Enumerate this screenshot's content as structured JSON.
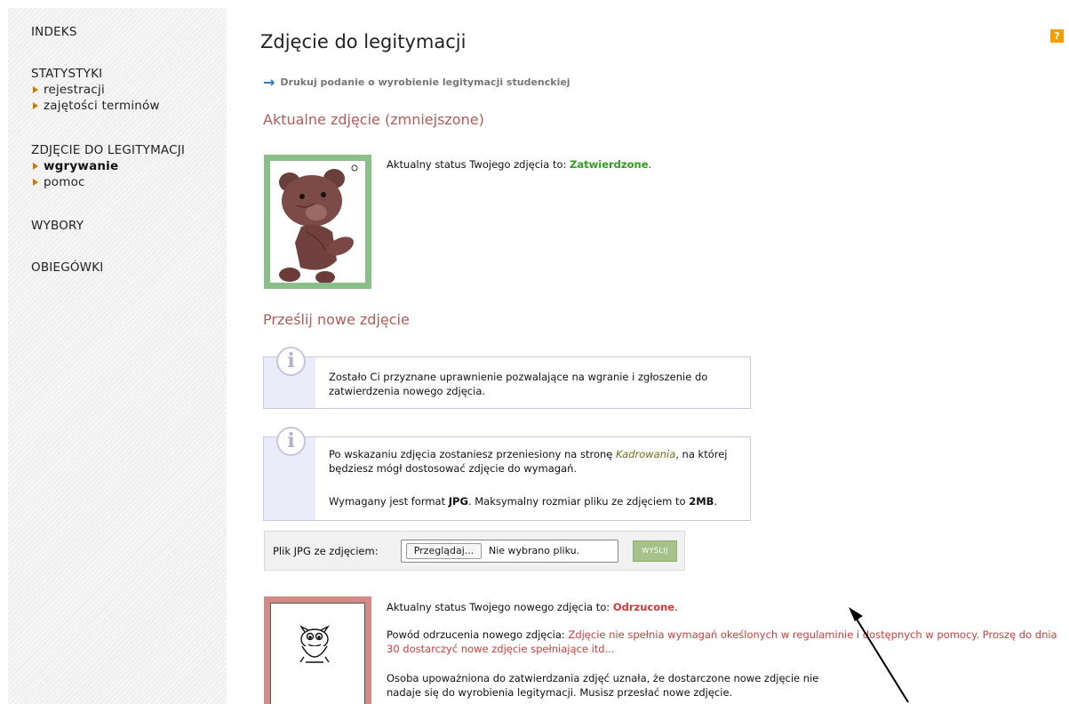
{
  "sidebar": {
    "indeks": "INDEKS",
    "statystyki": {
      "title": "STATYSTYKI",
      "items": [
        "rejestracji",
        "zajętości terminów"
      ]
    },
    "zdjecie": {
      "title": "ZDJĘCIE DO LEGITYMACJI",
      "items": [
        "wgrywanie",
        "pomoc"
      ]
    },
    "wybory": "WYBORY",
    "obiegowki": "OBIEGÓWKI"
  },
  "help_icon": "?",
  "page_title": "Zdjęcie do legitymacji",
  "print_link": "Drukuj podanie o wyrobienie legitymacji studenckiej",
  "current_photo": {
    "heading": "Aktualne zdjęcie (zmniejszone)",
    "status_prefix": "Aktualny status Twojego zdjęcia to:",
    "status_value": "Zatwierdzone",
    "status_suffix": "."
  },
  "upload": {
    "heading": "Prześlij nowe zdjęcie",
    "info1": "Zostało Ci przyznane uprawnienie pozwalające na wgranie i zgłoszenie do zatwierdzenia nowego zdjęcia.",
    "info2_prefix": "Po wskazaniu zdjęcia zostaniesz przeniesiony na stronę",
    "info2_link": "Kadrowania",
    "info2_suffix": ", na której będziesz mógł dostosować zdjęcie do wymagań.",
    "info3_a": "Wymagany jest format",
    "info3_fmt": "JPG",
    "info3_b": ". Maksymalny rozmiar pliku ze zdjęciem to",
    "info3_size": "2MB",
    "info3_c": ".",
    "file_label": "Plik JPG ze zdjęciem:",
    "browse": "Przeglądaj...",
    "no_file": "Nie wybrano pliku.",
    "send": "WYŚLIJ"
  },
  "new_photo": {
    "status_prefix": "Aktualny status Twojego nowego zdjęcia to:",
    "status_value": "Odrzucone",
    "status_suffix": ".",
    "reason_label": "Powód odrzucenia nowego zdjęcia:",
    "reason_text": "Zdjęcie nie spełnia wymagań okeślonych w regulaminie i dostępnych w pomocy. Proszę do dnia 30 dostarczyć nowe zdjęcie spełniające itd...",
    "note": "Osoba upoważniona do zatwierdzania zdjęć uznała, że dostarczone nowe zdjęcie nie nadaje się do wyrobienia legitymacji. Musisz przesłać nowe zdjęcie."
  },
  "colors": {
    "accent_heading": "#b25b57",
    "approved": "#2e9e1b",
    "rejected": "#d23b3b",
    "help": "#f5a000"
  }
}
